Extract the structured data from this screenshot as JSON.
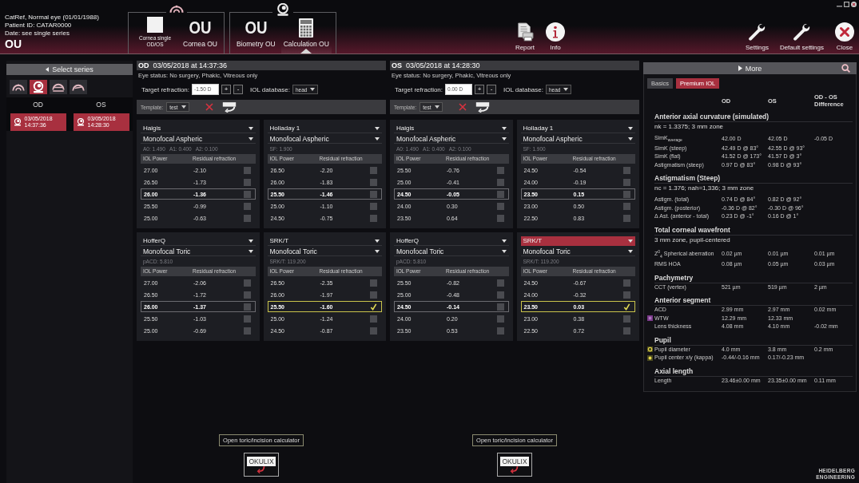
{
  "patient": {
    "name": "CatRef, Normal eye (01/01/1988)",
    "id": "Patient ID: CATAR0000",
    "date": "Date: see single series",
    "eye": "OU"
  },
  "nav_groups": [
    {
      "kind": "cornea",
      "items": [
        {
          "kind": "square",
          "label": "Cornea single OD/OS",
          "selected": false
        },
        {
          "kind": "big",
          "big": "OU",
          "label": "Cornea OU",
          "selected": false
        }
      ]
    },
    {
      "kind": "biometry",
      "items": [
        {
          "kind": "big",
          "big": "OU",
          "label": "Biometry OU",
          "selected": false
        },
        {
          "kind": "calculator",
          "label": "Calculation OU",
          "selected": true
        }
      ]
    }
  ],
  "toolbar_center": [
    {
      "kind": "report",
      "label": "Report"
    },
    {
      "kind": "info",
      "label": "Info"
    }
  ],
  "toolbar_right": [
    {
      "kind": "wrench",
      "label": "Settings"
    },
    {
      "kind": "wrench",
      "label": "Default settings"
    },
    {
      "kind": "close",
      "label": "Close"
    }
  ],
  "series_panel": {
    "button": "Select series",
    "tabs": [
      {
        "kind": "dome",
        "selected": false
      },
      {
        "kind": "lens",
        "selected": true
      },
      {
        "kind": "dome-bar",
        "selected": false
      },
      {
        "kind": "dome-line",
        "selected": false
      }
    ],
    "columns": [
      {
        "eye": "OD",
        "series": [
          {
            "date": "03/05/2018",
            "time": "14:37:36",
            "selected": true
          }
        ]
      },
      {
        "eye": "OS",
        "series": [
          {
            "date": "03/05/2018",
            "time": "14:28:30",
            "selected": true
          }
        ]
      }
    ]
  },
  "eyes": [
    {
      "eye": "OD",
      "datetime": "03/05/2018 at 14:37:36",
      "status": "Eye status: No surgery, Phakic, Vitreous only",
      "target_label": "Target refraction:",
      "target_value": "-1.50 D",
      "plus": "+",
      "minus": "-",
      "db_label": "IOL database:",
      "db_value": "head",
      "template_label": "Template:",
      "template_value": "test",
      "calculator_button": "Open toric/incision calculator",
      "okulix": "OKULIX",
      "formulas": [
        {
          "formula": "Haigis",
          "formula_selected": false,
          "lens": "Monofocal Aspheric",
          "constants": "A0: 1.490   A1: 0.400   A2: 0.100",
          "col1": "IOL Power",
          "col2": "Residual refraction",
          "rows": [
            {
              "power": "27.00",
              "residual": "-2.10",
              "emphasized": false,
              "checked": false
            },
            {
              "power": "26.50",
              "residual": "-1.73",
              "emphasized": false,
              "checked": false
            },
            {
              "power": "26.00",
              "residual": "-1.36",
              "emphasized": true,
              "checked": false
            },
            {
              "power": "25.50",
              "residual": "-0.99",
              "emphasized": false,
              "checked": false
            },
            {
              "power": "25.00",
              "residual": "-0.63",
              "emphasized": false,
              "checked": false
            }
          ]
        },
        {
          "formula": "Holladay 1",
          "formula_selected": false,
          "lens": "Monofocal Aspheric",
          "constants": "SF: 1.900",
          "col1": "IOL Power",
          "col2": "Residual refraction",
          "rows": [
            {
              "power": "26.50",
              "residual": "-2.20",
              "emphasized": false,
              "checked": false
            },
            {
              "power": "26.00",
              "residual": "-1.83",
              "emphasized": false,
              "checked": false
            },
            {
              "power": "25.50",
              "residual": "-1.46",
              "emphasized": true,
              "checked": false
            },
            {
              "power": "25.00",
              "residual": "-1.10",
              "emphasized": false,
              "checked": false
            },
            {
              "power": "24.50",
              "residual": "-0.75",
              "emphasized": false,
              "checked": false
            }
          ]
        },
        {
          "formula": "HofferQ",
          "formula_selected": false,
          "lens": "Monofocal Toric",
          "constants": "pACD: 5.810",
          "col1": "IOL Power",
          "col2": "Residual refraction",
          "rows": [
            {
              "power": "27.00",
              "residual": "-2.06",
              "emphasized": false,
              "checked": false
            },
            {
              "power": "26.50",
              "residual": "-1.72",
              "emphasized": false,
              "checked": false
            },
            {
              "power": "26.00",
              "residual": "-1.37",
              "emphasized": true,
              "checked": false
            },
            {
              "power": "25.50",
              "residual": "-1.03",
              "emphasized": false,
              "checked": false
            },
            {
              "power": "25.00",
              "residual": "-0.69",
              "emphasized": false,
              "checked": false
            }
          ]
        },
        {
          "formula": "SRK/T",
          "formula_selected": false,
          "lens": "Monofocal Toric",
          "constants": "SRK/T: 119.200",
          "col1": "IOL Power",
          "col2": "Residual refraction",
          "rows": [
            {
              "power": "26.50",
              "residual": "-2.35",
              "emphasized": false,
              "checked": false
            },
            {
              "power": "26.00",
              "residual": "-1.97",
              "emphasized": false,
              "checked": false
            },
            {
              "power": "25.50",
              "residual": "-1.60",
              "emphasized": true,
              "checked": true
            },
            {
              "power": "25.00",
              "residual": "-1.24",
              "emphasized": false,
              "checked": false
            },
            {
              "power": "24.50",
              "residual": "-0.87",
              "emphasized": false,
              "checked": false
            }
          ]
        }
      ]
    },
    {
      "eye": "OS",
      "datetime": "03/05/2018 at 14:28:30",
      "status": "Eye status: No surgery, Phakic, Vitreous only",
      "target_label": "Target refraction:",
      "target_value": "0.00 D",
      "plus": "+",
      "minus": "-",
      "db_label": "IOL database:",
      "db_value": "head",
      "template_label": "Template:",
      "template_value": "test",
      "calculator_button": "Open toric/incision calculator",
      "okulix": "OKULIX",
      "formulas": [
        {
          "formula": "Haigis",
          "formula_selected": false,
          "lens": "Monofocal Aspheric",
          "constants": "A0: 1.490   A1: 0.400   A2: 0.100",
          "col1": "IOL Power",
          "col2": "Residual refraction",
          "rows": [
            {
              "power": "25.50",
              "residual": "-0.76",
              "emphasized": false,
              "checked": false
            },
            {
              "power": "25.00",
              "residual": "-0.41",
              "emphasized": false,
              "checked": false
            },
            {
              "power": "24.50",
              "residual": "-0.05",
              "emphasized": true,
              "checked": false
            },
            {
              "power": "24.00",
              "residual": "0.30",
              "emphasized": false,
              "checked": false
            },
            {
              "power": "23.50",
              "residual": "0.64",
              "emphasized": false,
              "checked": false
            }
          ]
        },
        {
          "formula": "Holladay 1",
          "formula_selected": false,
          "lens": "Monofocal Aspheric",
          "constants": "SF: 1.900",
          "col1": "IOL Power",
          "col2": "Residual refraction",
          "rows": [
            {
              "power": "24.50",
              "residual": "-0.54",
              "emphasized": false,
              "checked": false
            },
            {
              "power": "24.00",
              "residual": "-0.19",
              "emphasized": false,
              "checked": false
            },
            {
              "power": "23.50",
              "residual": "0.15",
              "emphasized": true,
              "checked": false
            },
            {
              "power": "23.00",
              "residual": "0.50",
              "emphasized": false,
              "checked": false
            },
            {
              "power": "22.50",
              "residual": "0.83",
              "emphasized": false,
              "checked": false
            }
          ]
        },
        {
          "formula": "HofferQ",
          "formula_selected": false,
          "lens": "Monofocal Toric",
          "constants": "pACD: 5.810",
          "col1": "IOL Power",
          "col2": "Residual refraction",
          "rows": [
            {
              "power": "25.50",
              "residual": "-0.82",
              "emphasized": false,
              "checked": false
            },
            {
              "power": "25.00",
              "residual": "-0.48",
              "emphasized": false,
              "checked": false
            },
            {
              "power": "24.50",
              "residual": "-0.14",
              "emphasized": true,
              "checked": false
            },
            {
              "power": "24.00",
              "residual": "0.20",
              "emphasized": false,
              "checked": false
            },
            {
              "power": "23.50",
              "residual": "0.53",
              "emphasized": false,
              "checked": false
            }
          ]
        },
        {
          "formula": "SRK/T",
          "formula_selected": true,
          "lens": "Monofocal Toric",
          "constants": "SRK/T: 119.200",
          "col1": "IOL Power",
          "col2": "Residual refraction",
          "rows": [
            {
              "power": "24.50",
              "residual": "-0.67",
              "emphasized": false,
              "checked": false
            },
            {
              "power": "24.00",
              "residual": "-0.32",
              "emphasized": false,
              "checked": false
            },
            {
              "power": "23.50",
              "residual": "0.03",
              "emphasized": true,
              "checked": true
            },
            {
              "power": "23.00",
              "residual": "0.38",
              "emphasized": false,
              "checked": false
            },
            {
              "power": "22.50",
              "residual": "0.72",
              "emphasized": false,
              "checked": false
            }
          ]
        }
      ]
    }
  ],
  "info_panel": {
    "more": "More",
    "tabs": [
      {
        "label": "Basics",
        "selected": false
      },
      {
        "label": "Premium IOL",
        "selected": true
      }
    ],
    "columns": [
      "OD",
      "OS",
      "OD - OS Difference"
    ],
    "sections": [
      {
        "title": "Anterior axial curvature (simulated)",
        "subtitle": "nk = 1.3375; 3 mm zone",
        "rows": [
          {
            "label": "SimK$_{average}$",
            "od": "42.00 D",
            "os": "42.05 D",
            "diff": "-0.05 D"
          },
          {
            "label": "SimK (steep)",
            "od": "42.49 D @ 83°",
            "os": "42.55 D @ 93°"
          },
          {
            "label": "SimK (flat)",
            "od": "41.52 D @ 173°",
            "os": "41.57 D @ 3°"
          },
          {
            "label": "Astigmatism (steep)",
            "od": "0.97 D @ 83°",
            "os": "0.98 D @ 93°"
          }
        ]
      },
      {
        "title": "Astigmatism (Steep)",
        "subtitle": "nc = 1.376; nah=1,336; 3 mm zone",
        "rows": [
          {
            "label": "Astigm. (total)",
            "od": "0.74 D @ 84°",
            "os": "0.82 D @ 92°"
          },
          {
            "label": "Astigm. (posterior)",
            "od": "-0.36 D @ 82°",
            "os": "-0.30 D @ 96°"
          },
          {
            "label": "Δ Ast. (anterior - total)",
            "od": "0.23 D @ -1°",
            "os": "0.16 D @ 1°"
          }
        ]
      },
      {
        "title": "Total corneal wavefront",
        "subtitle": "3 mm zone, pupil-centered",
        "rows": [
          {
            "label": "Z$^{0}$$_{4}$ Spherical aberration",
            "od": "0.02 µm",
            "os": "0.01 µm",
            "diff": "0.01 µm"
          },
          {
            "label": "RMS HOA",
            "od": "0.08 µm",
            "os": "0.05 µm",
            "diff": "0.03 µm"
          }
        ]
      },
      {
        "title": "Pachymetry",
        "rows": [
          {
            "label": "CCT (vertex)",
            "od": "521 µm",
            "os": "519 µm",
            "diff": "2 µm"
          }
        ]
      },
      {
        "title": "Anterior segment",
        "rows": [
          {
            "kind": "plain",
            "label": "ACD",
            "od": "2.99 mm",
            "os": "2.97 mm",
            "diff": "0.02 mm"
          },
          {
            "kind": "square",
            "label": "WTW",
            "od": "12.29 mm",
            "os": "12.33 mm"
          },
          {
            "kind": "plain",
            "label": "Lens thickness",
            "od": "4.08 mm",
            "os": "4.10 mm",
            "diff": "-0.02 mm"
          }
        ]
      },
      {
        "title": "Pupil",
        "rows": [
          {
            "kind": "ring",
            "label": "Pupil diameter",
            "od": "4.0 mm",
            "os": "3.8 mm",
            "diff": "0.2 mm"
          },
          {
            "kind": "sun",
            "label": "Pupil center x/y (kappa)",
            "od": "-0.44/-0.16 mm",
            "os": "0.17/-0.23 mm"
          }
        ]
      },
      {
        "title": "Axial length",
        "rows": [
          {
            "label": "Length",
            "od": "23.46±0.00 mm",
            "os": "23.35±0.00 mm",
            "diff": "0.11 mm"
          }
        ]
      }
    ]
  },
  "logo": "HEIDELBERG ENGINEERING"
}
